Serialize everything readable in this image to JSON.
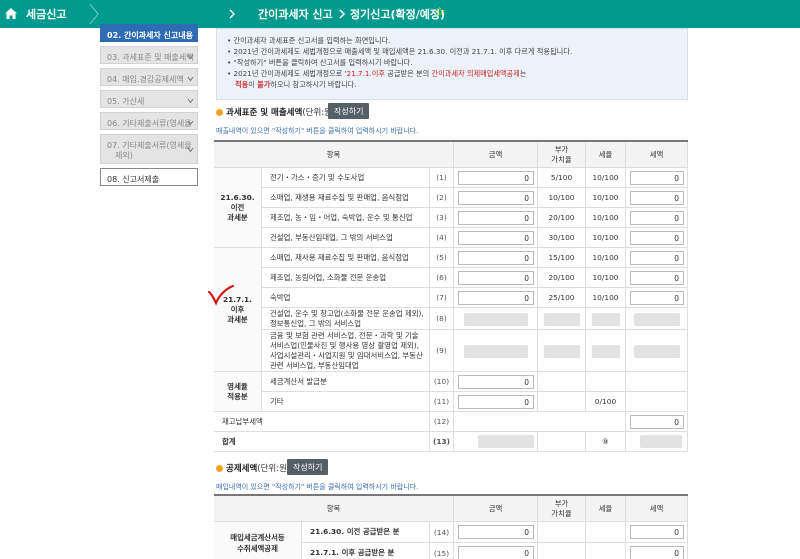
{
  "topbar": {
    "section": "세금신고",
    "crumb1": "간이과세자 신고",
    "crumb2": "정기신고(확정/예정)"
  },
  "sidebar": {
    "items": [
      {
        "label": "02. 간이과세자 신고내용"
      },
      {
        "label": "03. 과세표준 및 매출세액"
      },
      {
        "label": "04. 매입.경감공제세액"
      },
      {
        "label": "05. 가산세"
      },
      {
        "label": "06. 기타제출서류(영세율"
      },
      {
        "label": "07. 기타제출서류(영세율",
        "label2": "제외)"
      },
      {
        "label": "08. 신고서제출"
      }
    ]
  },
  "notice": {
    "line1": "간이과세자 과세표준 신고서를 입력하는 화면입니다.",
    "line2": "2021년 간이과세제도 세법개정으로 매출세액 및 매입세액은 21.6.30. 이전과 21.7.1. 이후 다르게 적용됩니다.",
    "line3": "\"작성하기\" 버튼을 클릭하여 신고서를 입력하시기 바랍니다.",
    "line4a": "2021년 간이과세제도 세법개정으로 '",
    "line4b": "21.7.1.이후",
    "line4c": " 공급받은 분의 ",
    "line4d": "간이과세자 의제매입세액공제",
    "line4e": "는",
    "line5a": "적용",
    "line5b": "이 ",
    "line5c": "불가",
    "line5d": "하오니 참고하시기 바랍니다."
  },
  "section1": {
    "title": "과세표준 및 매출세액",
    "unit": "(단위:원)",
    "button": "작성하기",
    "hint": "매출내역이 있으면 \"작성하기\" 버튼을 클릭하여 입력하시기 바랍니다."
  },
  "table1": {
    "headers": {
      "item": "항목",
      "amount": "금액",
      "vat1": "부가",
      "vat2": "가치율",
      "rate": "세율",
      "tax": "세액"
    },
    "group_a": [
      "21.6.30.",
      "이전",
      "과세분"
    ],
    "group_b": [
      "21.7.1.",
      "이후",
      "과세분"
    ],
    "group_c": [
      "영세율",
      "적용분"
    ],
    "rows": [
      {
        "label": "전기・가스・증기 및 수도사업",
        "no": "(1)",
        "amount": "0",
        "vat": "5/100",
        "rate": "10/100",
        "tax": "0"
      },
      {
        "label": "소매업, 재생용 재료수집 및 판매업, 음식점업",
        "no": "(2)",
        "amount": "0",
        "vat": "10/100",
        "rate": "10/100",
        "tax": "0"
      },
      {
        "label": "제조업, 농・임・어업, 숙박업, 운수 및 통신업",
        "no": "(3)",
        "amount": "0",
        "vat": "20/100",
        "rate": "10/100",
        "tax": "0"
      },
      {
        "label": "건설업, 부동산임대업, 그 밖의 서비스업",
        "no": "(4)",
        "amount": "0",
        "vat": "30/100",
        "rate": "10/100",
        "tax": "0"
      },
      {
        "label": "소매업, 재사용 재료수집 및 판매업, 음식점업",
        "no": "(5)",
        "amount": "0",
        "vat": "15/100",
        "rate": "10/100",
        "tax": "0"
      },
      {
        "label": "제조업, 농림어업, 소화물 전문 운송업",
        "no": "(6)",
        "amount": "0",
        "vat": "20/100",
        "rate": "10/100",
        "tax": "0"
      },
      {
        "label": "숙박업",
        "no": "(7)",
        "amount": "0",
        "vat": "25/100",
        "rate": "10/100",
        "tax": "0"
      },
      {
        "label": "건설업, 운수 및 창고업(소화물 전문 운송업 제외), 정보통신업, 그 밖의 서비스업",
        "no": "(8)"
      },
      {
        "label": "금융 및 보험 관련 서비스업, 전문・과학 및 기술서비스업(인물사진 및 행사용 영상 촬영업 제외), 사업시설관리・사업지원 및 임대서비스업, 부동산 관련 서비스업, 부동산임대업",
        "no": "(9)"
      },
      {
        "label": "세금계산서 발급분",
        "no": "(10)",
        "amount": "0"
      },
      {
        "label": "기타",
        "no": "(11)",
        "amount": "0",
        "rate": "0/100"
      }
    ],
    "reserve": {
      "label": "재고납부세액",
      "no": "(12)",
      "tax": "0"
    },
    "total": {
      "label": "합계",
      "no": "(13)",
      "mark": "⑨"
    }
  },
  "section2": {
    "title": "공제세액",
    "unit": "(단위:원)",
    "button": "작성하기",
    "hint": "매입내역이 있으면 \"작성하기\" 버튼을 클릭하여 입력하시기 바랍니다."
  },
  "table2": {
    "headers": {
      "item": "항목",
      "amount": "금액",
      "vat1": "부가",
      "vat2": "가치율",
      "rate": "세율",
      "tax": "세액"
    },
    "group": [
      "매입세금계산서등",
      "수취세액공제"
    ],
    "rows": [
      {
        "label": "21.6.30. 이전 공급받은 분",
        "no": "(14)",
        "amount": "0",
        "tax": "0"
      },
      {
        "label": "21.7.1. 이후 공급받은 분",
        "no": "(15)",
        "amount": "0",
        "tax": "0"
      }
    ]
  },
  "colors": {
    "topbar": "#009a8e",
    "active_tab": "#2e6cb3",
    "notice_bg": "#edf2f8",
    "annotation_red": "#d41414"
  }
}
